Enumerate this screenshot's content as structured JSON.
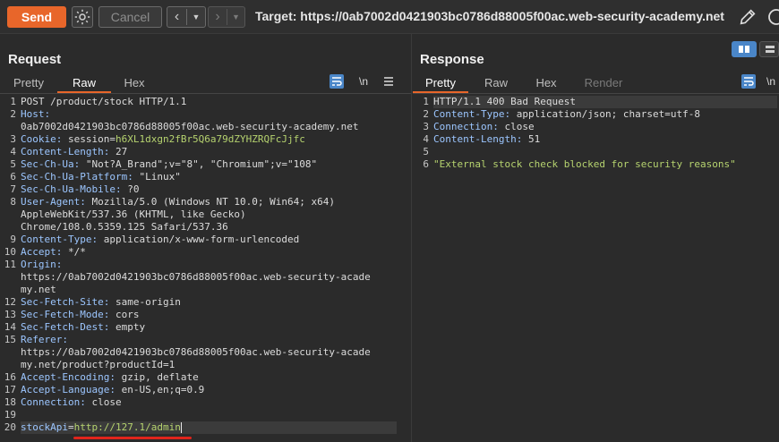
{
  "toolbar": {
    "send_label": "Send",
    "cancel_label": "Cancel",
    "target": "Target: https://0ab7002d0421903bc0786d88005f00ac.web-security-academy.net"
  },
  "request": {
    "title": "Request",
    "tabs": [
      "Pretty",
      "Raw",
      "Hex"
    ],
    "active_tab": "Raw",
    "newline_toggle": "\\n",
    "lines": [
      {
        "n": "1",
        "segments": [
          {
            "t": "POST /product/stock HTTP/1.1",
            "c": "hv"
          }
        ]
      },
      {
        "n": "2",
        "segments": [
          {
            "t": "Host:",
            "c": "hk"
          }
        ]
      },
      {
        "n": "",
        "segments": [
          {
            "t": "0ab7002d0421903bc0786d88005f00ac.web-security-academy.net",
            "c": "hv"
          }
        ]
      },
      {
        "n": "3",
        "segments": [
          {
            "t": "Cookie: ",
            "c": "hk"
          },
          {
            "t": "session",
            "c": "hv"
          },
          {
            "t": "=",
            "c": "hv"
          },
          {
            "t": "h6XL1dxgn2fBr5Q6a79dZYHZRQFcJjfc",
            "c": "cook"
          }
        ]
      },
      {
        "n": "4",
        "segments": [
          {
            "t": "Content-Length: ",
            "c": "hk"
          },
          {
            "t": "27",
            "c": "hv"
          }
        ]
      },
      {
        "n": "5",
        "segments": [
          {
            "t": "Sec-Ch-Ua: ",
            "c": "hk"
          },
          {
            "t": "\"Not?A_Brand\";v=\"8\", \"Chromium\";v=\"108\"",
            "c": "hv"
          }
        ]
      },
      {
        "n": "6",
        "segments": [
          {
            "t": "Sec-Ch-Ua-Platform: ",
            "c": "hk"
          },
          {
            "t": "\"Linux\"",
            "c": "hv"
          }
        ]
      },
      {
        "n": "7",
        "segments": [
          {
            "t": "Sec-Ch-Ua-Mobile: ",
            "c": "hk"
          },
          {
            "t": "?0",
            "c": "hv"
          }
        ]
      },
      {
        "n": "8",
        "segments": [
          {
            "t": "User-Agent: ",
            "c": "hk"
          },
          {
            "t": "Mozilla/5.0 (Windows NT 10.0; Win64; x64)",
            "c": "hv"
          }
        ]
      },
      {
        "n": "",
        "segments": [
          {
            "t": "AppleWebKit/537.36 (KHTML, like Gecko)",
            "c": "hv"
          }
        ]
      },
      {
        "n": "",
        "segments": [
          {
            "t": "Chrome/108.0.5359.125 Safari/537.36",
            "c": "hv"
          }
        ]
      },
      {
        "n": "9",
        "segments": [
          {
            "t": "Content-Type: ",
            "c": "hk"
          },
          {
            "t": "application/x-www-form-urlencoded",
            "c": "hv"
          }
        ]
      },
      {
        "n": "10",
        "segments": [
          {
            "t": "Accept: ",
            "c": "hk"
          },
          {
            "t": "*/*",
            "c": "hv"
          }
        ]
      },
      {
        "n": "11",
        "segments": [
          {
            "t": "Origin:",
            "c": "hk"
          }
        ]
      },
      {
        "n": "",
        "segments": [
          {
            "t": "https://0ab7002d0421903bc0786d88005f00ac.web-security-acade",
            "c": "hv"
          }
        ]
      },
      {
        "n": "",
        "segments": [
          {
            "t": "my.net",
            "c": "hv"
          }
        ]
      },
      {
        "n": "12",
        "segments": [
          {
            "t": "Sec-Fetch-Site: ",
            "c": "hk"
          },
          {
            "t": "same-origin",
            "c": "hv"
          }
        ]
      },
      {
        "n": "13",
        "segments": [
          {
            "t": "Sec-Fetch-Mode: ",
            "c": "hk"
          },
          {
            "t": "cors",
            "c": "hv"
          }
        ]
      },
      {
        "n": "14",
        "segments": [
          {
            "t": "Sec-Fetch-Dest: ",
            "c": "hk"
          },
          {
            "t": "empty",
            "c": "hv"
          }
        ]
      },
      {
        "n": "15",
        "segments": [
          {
            "t": "Referer:",
            "c": "hk"
          }
        ]
      },
      {
        "n": "",
        "segments": [
          {
            "t": "https://0ab7002d0421903bc0786d88005f00ac.web-security-acade",
            "c": "hv"
          }
        ]
      },
      {
        "n": "",
        "segments": [
          {
            "t": "my.net/product?productId=1",
            "c": "hv"
          }
        ]
      },
      {
        "n": "16",
        "segments": [
          {
            "t": "Accept-Encoding: ",
            "c": "hk"
          },
          {
            "t": "gzip, deflate",
            "c": "hv"
          }
        ]
      },
      {
        "n": "17",
        "segments": [
          {
            "t": "Accept-Language: ",
            "c": "hk"
          },
          {
            "t": "en-US,en;q=0.9",
            "c": "hv"
          }
        ]
      },
      {
        "n": "18",
        "segments": [
          {
            "t": "Connection: ",
            "c": "hk"
          },
          {
            "t": "close",
            "c": "hv"
          }
        ]
      },
      {
        "n": "19",
        "segments": []
      },
      {
        "n": "20",
        "segments": [
          {
            "t": "stockApi",
            "c": "hk"
          },
          {
            "t": "=",
            "c": "hv"
          },
          {
            "t": "http://127.1/admin",
            "c": "strg"
          }
        ],
        "selected": true
      }
    ]
  },
  "response": {
    "title": "Response",
    "tabs": [
      "Pretty",
      "Raw",
      "Hex",
      "Render"
    ],
    "active_tab": "Pretty",
    "newline_toggle": "\\n",
    "lines": [
      {
        "n": "1",
        "segments": [
          {
            "t": "HTTP/1.1 400 Bad Request",
            "c": "hv"
          }
        ],
        "selected": true
      },
      {
        "n": "2",
        "segments": [
          {
            "t": "Content-Type: ",
            "c": "hk"
          },
          {
            "t": "application/json; charset=utf-8",
            "c": "hv"
          }
        ]
      },
      {
        "n": "3",
        "segments": [
          {
            "t": "Connection: ",
            "c": "hk"
          },
          {
            "t": "close",
            "c": "hv"
          }
        ]
      },
      {
        "n": "4",
        "segments": [
          {
            "t": "Content-Length: ",
            "c": "hk"
          },
          {
            "t": "51",
            "c": "hv"
          }
        ]
      },
      {
        "n": "5",
        "segments": []
      },
      {
        "n": "6",
        "segments": [
          {
            "t": "\"External stock check blocked for security reasons\"",
            "c": "strg"
          }
        ]
      }
    ]
  },
  "colors": {
    "accent": "#e8662a",
    "background": "#2b2b2b",
    "underline": "#e0241c"
  }
}
